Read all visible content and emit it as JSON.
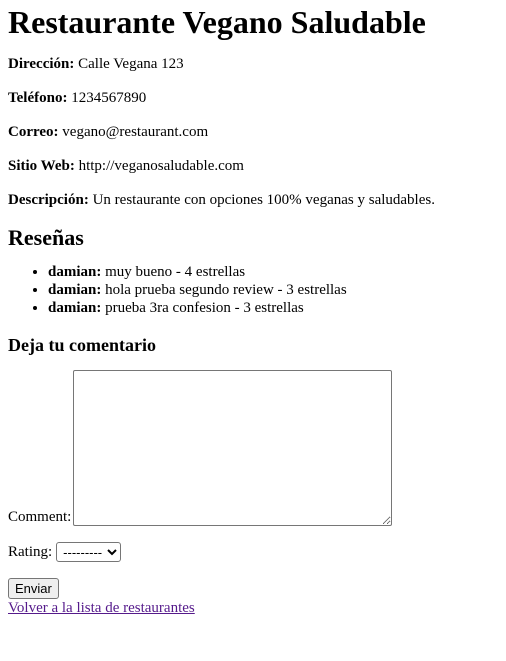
{
  "restaurant": {
    "name": "Restaurante Vegano Saludable",
    "address_label": "Dirección:",
    "address": "Calle Vegana 123",
    "phone_label": "Teléfono:",
    "phone": "1234567890",
    "email_label": "Correo:",
    "email": "vegano@restaurant.com",
    "website_label": "Sitio Web:",
    "website": "http://veganosaludable.com",
    "description_label": "Descripción:",
    "description": "Un restaurante con opciones 100% veganas y saludables."
  },
  "reviews": {
    "heading": "Reseñas",
    "items": [
      {
        "author": "damian:",
        "text": "muy bueno - 4 estrellas"
      },
      {
        "author": "damian:",
        "text": "hola prueba segundo review - 3 estrellas"
      },
      {
        "author": "damian:",
        "text": "prueba 3ra confesion - 3 estrellas"
      }
    ]
  },
  "form": {
    "heading": "Deja tu comentario",
    "comment_label": "Comment:",
    "comment_value": "",
    "rating_label": "Rating:",
    "rating_selected": "---------",
    "submit_label": "Enviar"
  },
  "back_link": "Volver a la lista de restaurantes"
}
